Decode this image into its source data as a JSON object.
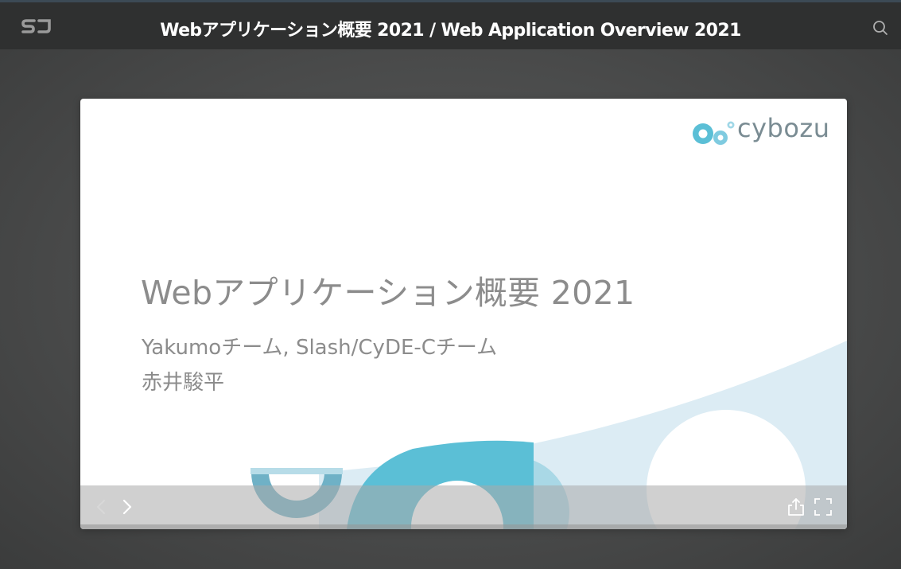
{
  "header": {
    "logo_icon": "sj-logo-icon",
    "title": "Webアプリケーション概要 2021 / Web Application Overview 2021",
    "search_icon": "search-icon"
  },
  "slide": {
    "brand": "cybozu",
    "brand_icon": "cybozu-logo-icon",
    "title": "Webアプリケーション概要 2021",
    "subtitle": "Yakumoチーム, Slash/CyDE-Cチーム",
    "author": "赤井駿平",
    "colors": {
      "accent_blue": "#5bbfd6",
      "dark_teal": "#3f9fb8",
      "light_blue": "#dcecf4",
      "text_gray": "#8c8c8c"
    }
  },
  "controls": {
    "prev_icon": "chevron-left-icon",
    "next_icon": "chevron-right-icon",
    "share_icon": "share-icon",
    "fullscreen_icon": "fullscreen-icon"
  }
}
